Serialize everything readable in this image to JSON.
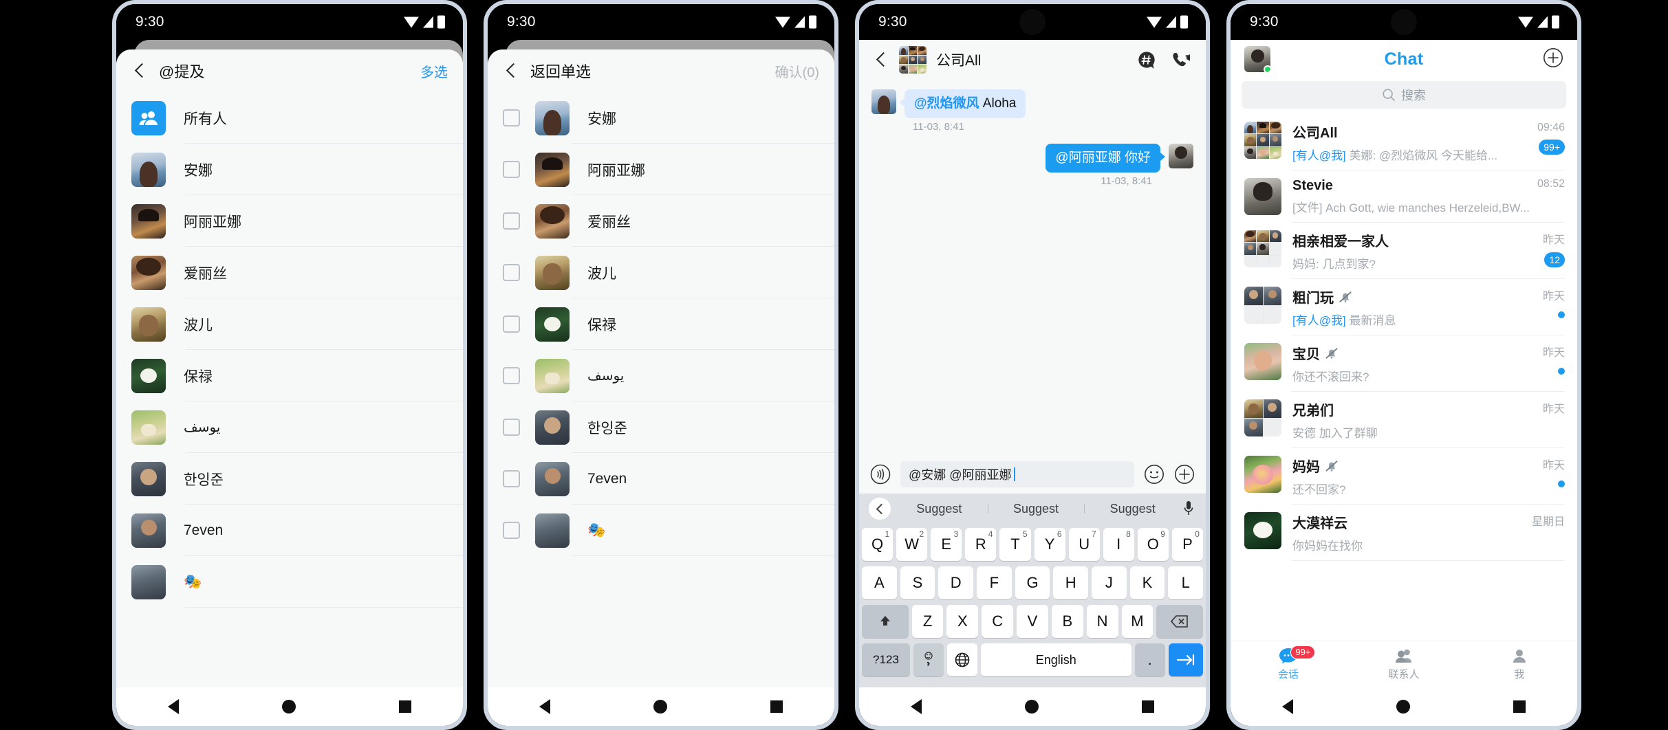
{
  "status_bar": {
    "time": "9:30"
  },
  "panel1": {
    "name": "mention-picker",
    "header": {
      "title": "@提及",
      "action": "多选",
      "back_icon": "chevron-left-icon"
    },
    "rows": [
      {
        "name": "所有人",
        "avatar": "all-people-icon",
        "kind": "all"
      },
      {
        "name": "安娜",
        "avatar": "a-anna"
      },
      {
        "name": "阿丽亚娜",
        "avatar": "a-ariana"
      },
      {
        "name": "爱丽丝",
        "avatar": "a-alice"
      },
      {
        "name": "波儿",
        "avatar": "a-boer"
      },
      {
        "name": "保禄",
        "avatar": "a-baolu"
      },
      {
        "name": "يوسف",
        "avatar": "a-yusuf",
        "rtl": true
      },
      {
        "name": "한잉준",
        "avatar": "a-han"
      },
      {
        "name": "7even",
        "avatar": "a-7even"
      },
      {
        "name": "🎭",
        "avatar": "a-emoji"
      }
    ]
  },
  "panel2": {
    "name": "mention-multiselect",
    "header": {
      "title": "返回单选",
      "action": "确认(0)",
      "back_icon": "chevron-left-icon"
    },
    "rows": [
      {
        "name": "安娜",
        "avatar": "a-anna",
        "checked": false
      },
      {
        "name": "阿丽亚娜",
        "avatar": "a-ariana",
        "checked": false
      },
      {
        "name": "爱丽丝",
        "avatar": "a-alice",
        "checked": false
      },
      {
        "name": "波儿",
        "avatar": "a-boer",
        "checked": false
      },
      {
        "name": "保禄",
        "avatar": "a-baolu",
        "checked": false
      },
      {
        "name": "يوسف",
        "avatar": "a-yusuf",
        "checked": false,
        "rtl": true
      },
      {
        "name": "한잉준",
        "avatar": "a-han",
        "checked": false
      },
      {
        "name": "7even",
        "avatar": "a-7even",
        "checked": false
      },
      {
        "name": "🎭",
        "avatar": "a-emoji",
        "checked": false
      }
    ]
  },
  "panel3": {
    "name": "group-chat",
    "header": {
      "title": "公司All",
      "back_icon": "chevron-left-icon",
      "hash_icon": "hashtag-bubble-icon",
      "call_icon": "video-call-icon"
    },
    "messages": [
      {
        "dir": "in",
        "mention": "@烈焰微风",
        "text": " Aloha",
        "time": "11-03, 8:41"
      },
      {
        "dir": "out",
        "mention": "@阿丽亚娜",
        "text": " 你好",
        "time": "11-03, 8:41"
      }
    ],
    "input": {
      "value": "@安娜 @阿丽亚娜",
      "voice_icon": "voice-wave-icon",
      "emoji_icon": "smiley-icon",
      "plus_icon": "plus-circle-icon"
    },
    "suggestions": {
      "back_icon": "chevron-left-circle-icon",
      "items": [
        "Suggest",
        "Suggest",
        "Suggest"
      ],
      "mic_icon": "microphone-icon"
    },
    "keyboard": {
      "row1": [
        {
          "k": "Q",
          "s": "1"
        },
        {
          "k": "W",
          "s": "2"
        },
        {
          "k": "E",
          "s": "3"
        },
        {
          "k": "R",
          "s": "4"
        },
        {
          "k": "T",
          "s": "5"
        },
        {
          "k": "Y",
          "s": "6"
        },
        {
          "k": "U",
          "s": "7"
        },
        {
          "k": "I",
          "s": "8"
        },
        {
          "k": "O",
          "s": "9"
        },
        {
          "k": "P",
          "s": "0"
        }
      ],
      "row2": [
        {
          "k": "A"
        },
        {
          "k": "S"
        },
        {
          "k": "D"
        },
        {
          "k": "F"
        },
        {
          "k": "G"
        },
        {
          "k": "H"
        },
        {
          "k": "J"
        },
        {
          "k": "K"
        },
        {
          "k": "L"
        }
      ],
      "row3": [
        {
          "k": "Z"
        },
        {
          "k": "X"
        },
        {
          "k": "C"
        },
        {
          "k": "V"
        },
        {
          "k": "B"
        },
        {
          "k": "N"
        },
        {
          "k": "M"
        }
      ],
      "shift_icon": "shift-up-icon",
      "backspace_icon": "backspace-icon",
      "row4": {
        "symbols": "?123",
        "emoji_icon": "emoji-comma-icon",
        "globe_icon": "globe-icon",
        "space": "English",
        "period": ".",
        "enter_icon": "enter-arrow-icon"
      }
    }
  },
  "panel4": {
    "name": "chat-list",
    "header": {
      "title": "Chat",
      "avatar": "a-me",
      "plus_icon": "plus-circle-icon"
    },
    "search": {
      "placeholder": "搜索",
      "icon": "search-icon"
    },
    "items": [
      {
        "name": "公司All",
        "prefix": "[有人@我]",
        "preview": " 美娜: @烈焰微风 今天能给...",
        "time": "09:46",
        "badge": "99+",
        "avatar": "grid9",
        "muted": false
      },
      {
        "name": "Stevie",
        "prefix": "",
        "preview": "[文件] Ach Gott, wie manches Herzeleid,BW...",
        "time": "08:52",
        "avatar": "a-stevie",
        "muted": false
      },
      {
        "name": "相亲相爱一家人",
        "prefix": "",
        "preview": "妈妈: 几点到家?",
        "time": "昨天",
        "badge": "12",
        "avatar": "grid5",
        "muted": false
      },
      {
        "name": "粗门玩",
        "prefix": "[有人@我]",
        "preview": " 最新消息",
        "time": "昨天",
        "dot": true,
        "avatar": "grid2",
        "muted": true
      },
      {
        "name": "宝贝",
        "prefix": "",
        "preview": "你还不滚回来?",
        "time": "昨天",
        "dot": true,
        "avatar": "a-baobei",
        "muted": true
      },
      {
        "name": "兄弟们",
        "prefix": "",
        "preview": "安德 加入了群聊",
        "time": "昨天",
        "avatar": "grid3",
        "muted": false
      },
      {
        "name": "妈妈",
        "prefix": "",
        "preview": "还不回家?",
        "time": "昨天",
        "dot": true,
        "avatar": "a-rose",
        "muted": true
      },
      {
        "name": "大漠祥云",
        "prefix": "",
        "preview": "你妈妈在找你",
        "time": "星期日",
        "avatar": "a-lotus",
        "muted": false
      }
    ],
    "tabs": [
      {
        "label": "会话",
        "icon": "chat-bubble-icon",
        "active": true,
        "badge": "99+"
      },
      {
        "label": "联系人",
        "icon": "contacts-icon",
        "active": false
      },
      {
        "label": "我",
        "icon": "person-icon",
        "active": false
      }
    ]
  },
  "nav": {
    "back_icon": "triangle-back-icon",
    "home_icon": "circle-home-icon",
    "recents_icon": "square-recents-icon"
  },
  "colors": {
    "accent": "#1b9cf0",
    "mention": "#2196f3",
    "badge_red": "#f4374a",
    "online": "#1ed760",
    "sheet_bg": "#f7f9f9"
  }
}
